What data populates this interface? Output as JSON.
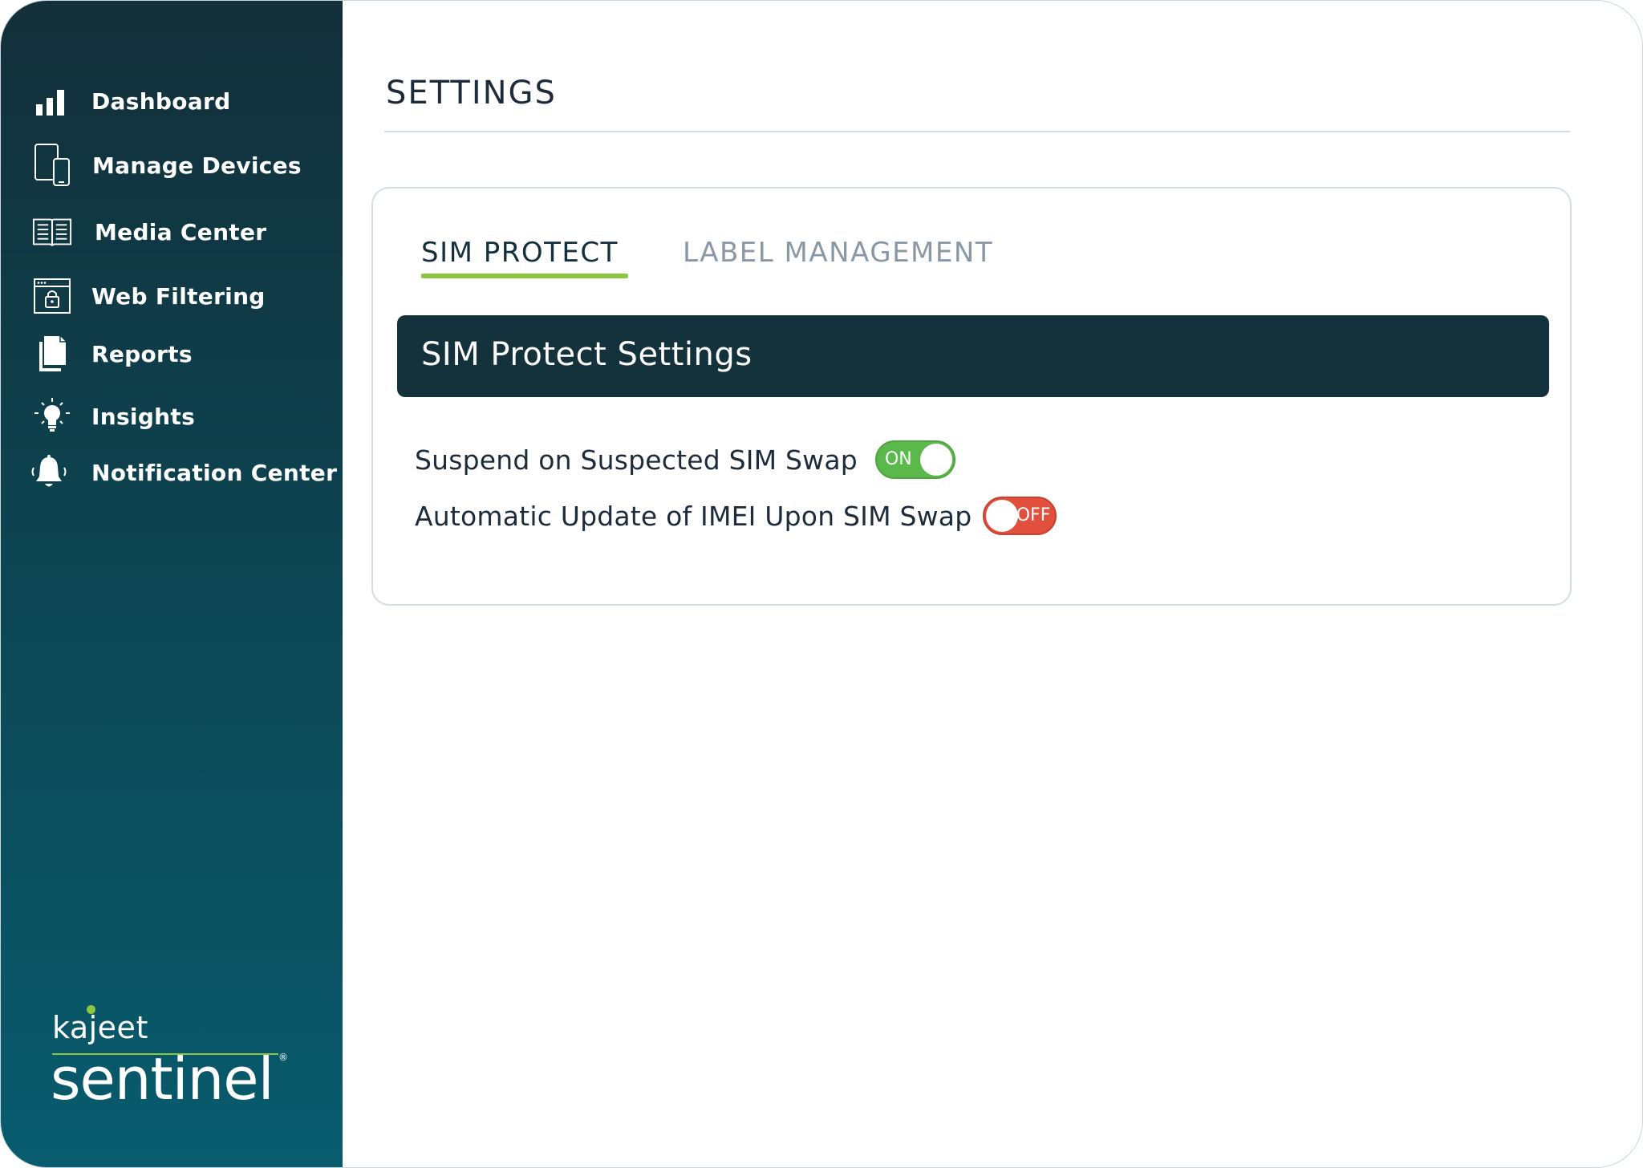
{
  "sidebar": {
    "items": [
      {
        "label": "Dashboard",
        "icon": "bar-chart-icon"
      },
      {
        "label": "Manage Devices",
        "icon": "devices-icon"
      },
      {
        "label": "Media Center",
        "icon": "open-book-icon"
      },
      {
        "label": "Web Filtering",
        "icon": "browser-lock-icon"
      },
      {
        "label": "Reports",
        "icon": "documents-icon"
      },
      {
        "label": "Insights",
        "icon": "lightbulb-icon"
      },
      {
        "label": "Notification Center",
        "icon": "bell-icon"
      }
    ],
    "logo": {
      "brand": "kajeet",
      "product": "sentinel",
      "registered": "®"
    }
  },
  "header": {
    "title": "SETTINGS"
  },
  "tabs": [
    {
      "label": "SIM PROTECT",
      "active": true
    },
    {
      "label": "LABEL MANAGEMENT",
      "active": false
    }
  ],
  "section": {
    "title": "SIM Protect Settings",
    "settings": [
      {
        "label": "Suspend on Suspected SIM Swap",
        "state_label": "ON",
        "enabled": true
      },
      {
        "label": "Automatic Update of IMEI Upon SIM Swap",
        "state_label": "OFF",
        "enabled": false
      }
    ]
  },
  "colors": {
    "sidebar_top": "#132f39",
    "sidebar_bottom": "#085c6e",
    "accent_green": "#8dc63f",
    "toggle_on": "#5bb84a",
    "toggle_off": "#e0503c",
    "section_header": "#14323b"
  }
}
